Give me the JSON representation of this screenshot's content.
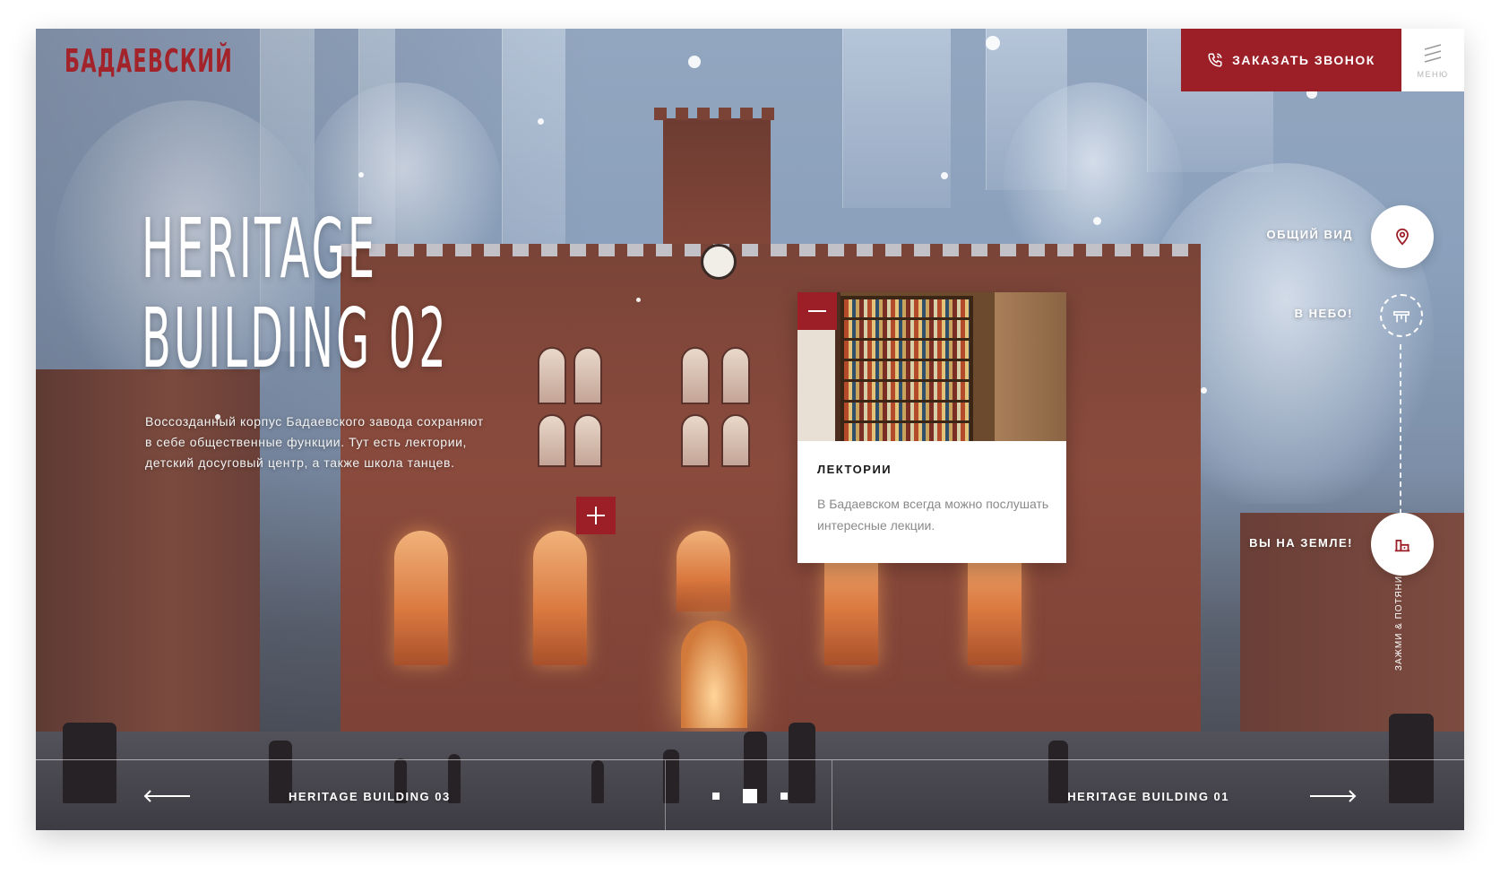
{
  "header": {
    "logo_text": "БАДАЕВСКИЙ",
    "callback_label": "ЗАКАЗАТЬ ЗВОНОК",
    "menu_label": "МЕНЮ"
  },
  "hero": {
    "title_line1": "HERITAGE",
    "title_line2": "BUILDING 02",
    "description": "Воссозданный корпус Бадаевского завода сохраняют в себе общественные функции. Тут есть лектории, детский досуговый центр, а также школа танцев."
  },
  "info_card": {
    "title": "ЛЕКТОРИИ",
    "text": "В Бадаевском всегда можно послушать интересные лекции."
  },
  "side_nav": {
    "general_view_label": "ОБЩИЙ ВИД",
    "sky_label": "В НЕБО!",
    "ground_label": "ВЫ НА ЗЕМЛЕ!",
    "drag_hint": "ЗАЖМИ & ПОТЯНИ НАВЕРХ"
  },
  "bottom_nav": {
    "prev_label": "HERITAGE BUILDING 03",
    "next_label": "HERITAGE BUILDING 01",
    "pages": 3,
    "active_page": 2
  },
  "icons": {
    "phone": "phone-icon",
    "menu": "menu-lines-icon",
    "location": "location-pin-icon",
    "sky": "observation-deck-icon",
    "ground": "building-icon",
    "arrow_left": "arrow-left-icon",
    "arrow_right": "arrow-right-icon"
  },
  "colors": {
    "accent": "#9c1f27",
    "white": "#ffffff",
    "card_text": "#8a8a8a"
  }
}
